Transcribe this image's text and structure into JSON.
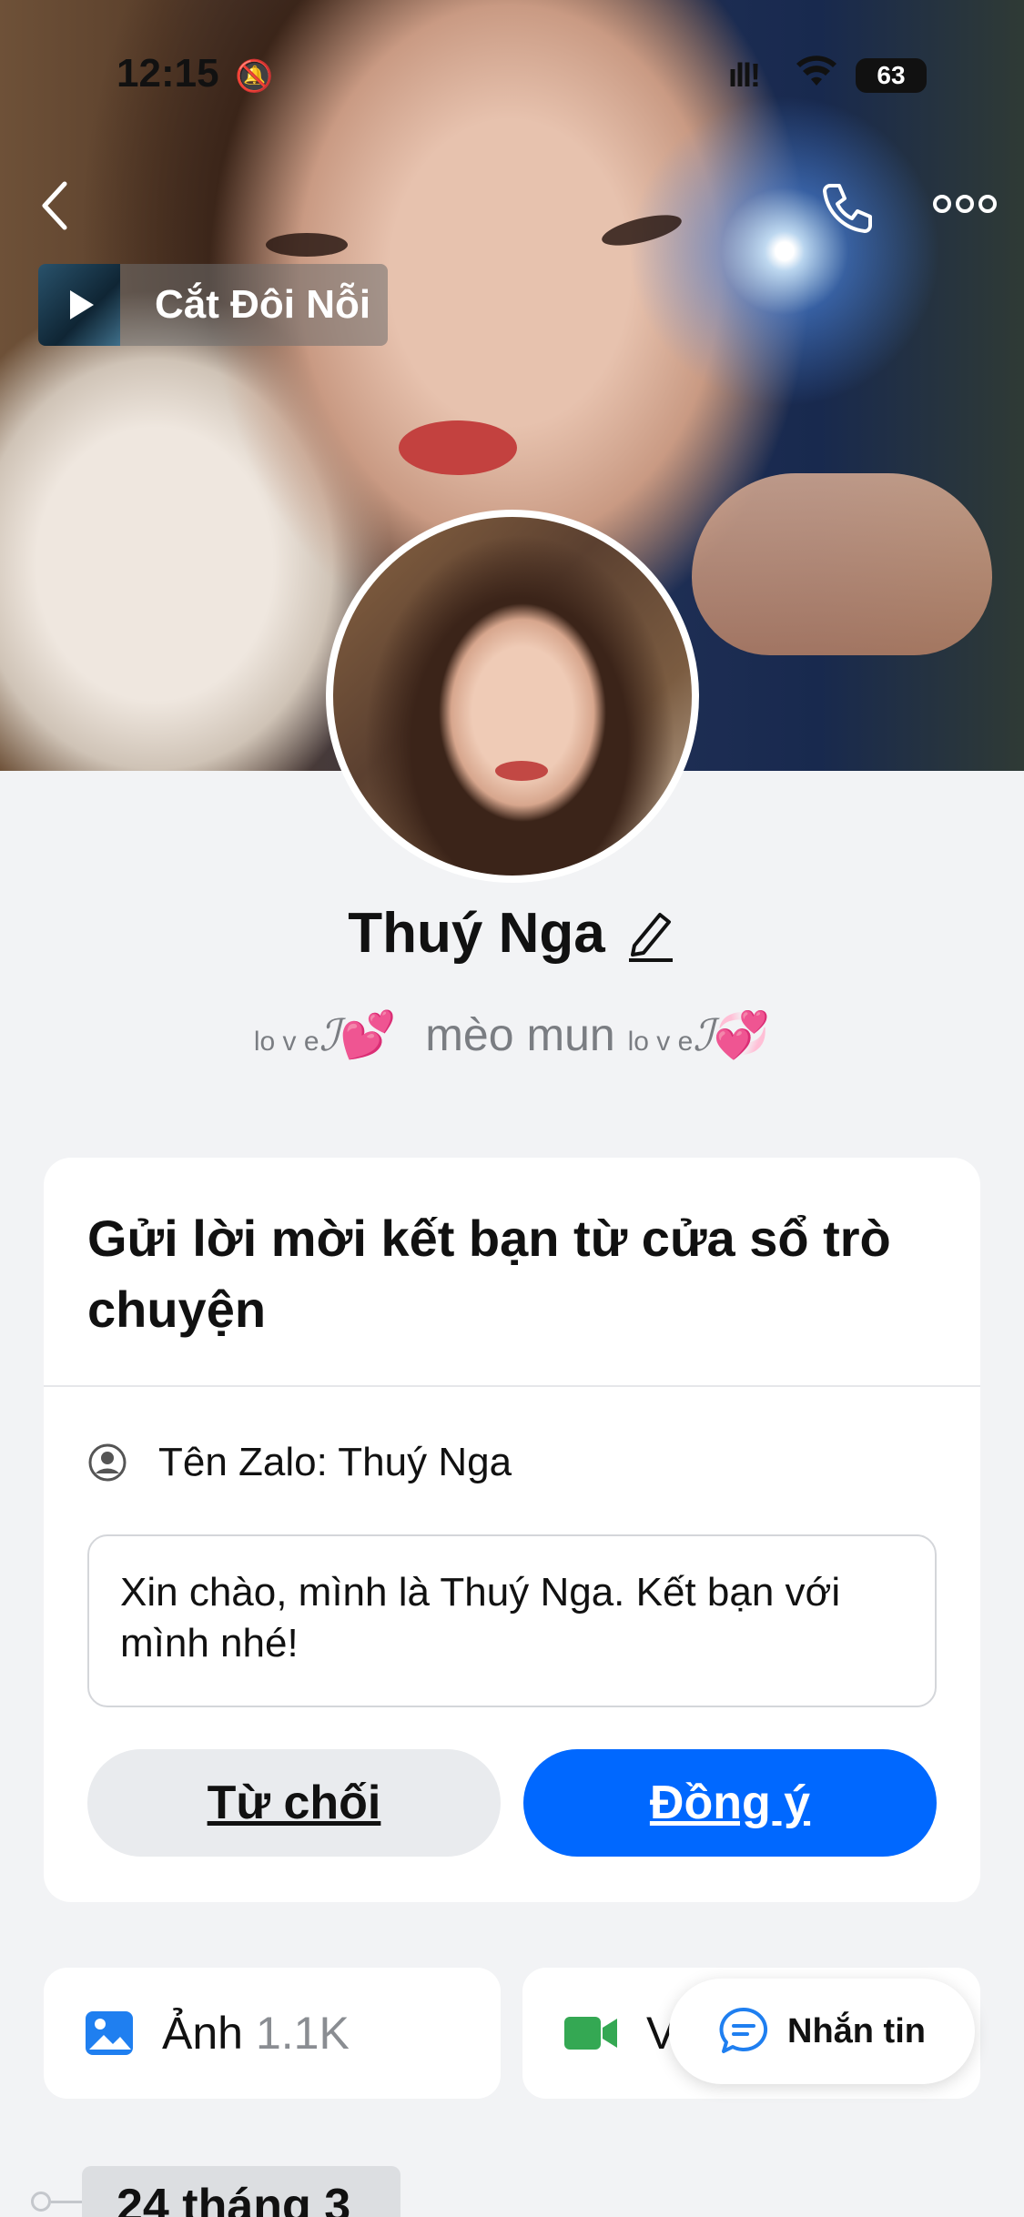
{
  "status_bar": {
    "time": "12:15",
    "battery": "63"
  },
  "cover": {
    "music_title": "Cắt Đôi Nỗi"
  },
  "profile": {
    "name": "Thuý Nga",
    "bio_prefix_small": "lo v e",
    "bio_prefix_script": "ℐ",
    "bio_heart": "💕",
    "bio_main": "mèo mun",
    "bio_suffix_small": "lo v e",
    "bio_suffix_script": "ℐ",
    "bio_suffix_heart": "💞"
  },
  "friend_request": {
    "title": "Gửi lời mời kết bạn từ cửa sổ trò chuyện",
    "zalo_name": "Tên Zalo: Thuý Nga",
    "message": "Xin chào, mình là Thuý Nga. Kết bạn với mình nhé!",
    "reject_label": "Từ chối",
    "accept_label": "Đồng ý"
  },
  "media": {
    "photos_label": "Ảnh",
    "photos_count": "1.1K",
    "videos_label": "V"
  },
  "chat_button": {
    "label": "Nhắn tin"
  },
  "timeline": {
    "date": "24 tháng 3"
  },
  "colors": {
    "accent": "#0068ff",
    "card_bg": "#ffffff",
    "page_bg": "#f2f3f5",
    "video_icon": "#34a853"
  }
}
